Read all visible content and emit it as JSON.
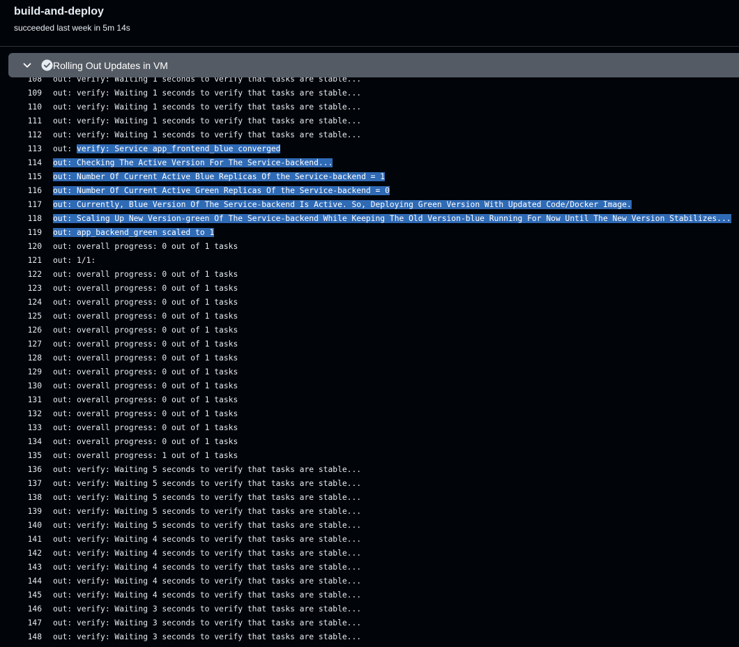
{
  "job": {
    "title": "build-and-deploy",
    "status": "succeeded last week in 5m 14s"
  },
  "step": {
    "title": "Rolling Out Updates in VM",
    "state_icon": "check-circle-icon",
    "expand_icon": "chevron-down-icon"
  },
  "colors": {
    "background": "#010409",
    "step_header": "#545b64",
    "selection": "#2f6ab5"
  },
  "log_lines": [
    {
      "num": "108",
      "text": "out: verify: Waiting 1 seconds to verify that tasks are stable...",
      "sel_start": null
    },
    {
      "num": "109",
      "text": "out: verify: Waiting 1 seconds to verify that tasks are stable...",
      "sel_start": null
    },
    {
      "num": "110",
      "text": "out: verify: Waiting 1 seconds to verify that tasks are stable...",
      "sel_start": null
    },
    {
      "num": "111",
      "text": "out: verify: Waiting 1 seconds to verify that tasks are stable...",
      "sel_start": null
    },
    {
      "num": "112",
      "text": "out: verify: Waiting 1 seconds to verify that tasks are stable...",
      "sel_start": null
    },
    {
      "num": "113",
      "text": "out: verify: Service app_frontend_blue converged",
      "sel_start": 5
    },
    {
      "num": "114",
      "text": "out: Checking The Active Version For The Service-backend...",
      "sel_start": 0
    },
    {
      "num": "115",
      "text": "out: Number Of Current Active Blue Replicas Of the Service-backend = 1",
      "sel_start": 0
    },
    {
      "num": "116",
      "text": "out: Number Of Current Active Green Replicas Of the Service-backend = 0",
      "sel_start": 0
    },
    {
      "num": "117",
      "text": "out: Currently, Blue Version Of The Service-backend Is Active. So, Deploying Green Version With Updated Code/Docker Image.",
      "sel_start": 0
    },
    {
      "num": "118",
      "text": "out: Scaling Up New Version-green Of The Service-backend While Keeping The Old Version-blue Running For Now Until The New Version Stabilizes...",
      "sel_start": 0
    },
    {
      "num": "119",
      "text": "out: app_backend_green scaled to 1",
      "sel_start": 0
    },
    {
      "num": "120",
      "text": "out: overall progress: 0 out of 1 tasks",
      "sel_start": null
    },
    {
      "num": "121",
      "text": "out: 1/1:",
      "sel_start": null
    },
    {
      "num": "122",
      "text": "out: overall progress: 0 out of 1 tasks",
      "sel_start": null
    },
    {
      "num": "123",
      "text": "out: overall progress: 0 out of 1 tasks",
      "sel_start": null
    },
    {
      "num": "124",
      "text": "out: overall progress: 0 out of 1 tasks",
      "sel_start": null
    },
    {
      "num": "125",
      "text": "out: overall progress: 0 out of 1 tasks",
      "sel_start": null
    },
    {
      "num": "126",
      "text": "out: overall progress: 0 out of 1 tasks",
      "sel_start": null
    },
    {
      "num": "127",
      "text": "out: overall progress: 0 out of 1 tasks",
      "sel_start": null
    },
    {
      "num": "128",
      "text": "out: overall progress: 0 out of 1 tasks",
      "sel_start": null
    },
    {
      "num": "129",
      "text": "out: overall progress: 0 out of 1 tasks",
      "sel_start": null
    },
    {
      "num": "130",
      "text": "out: overall progress: 0 out of 1 tasks",
      "sel_start": null
    },
    {
      "num": "131",
      "text": "out: overall progress: 0 out of 1 tasks",
      "sel_start": null
    },
    {
      "num": "132",
      "text": "out: overall progress: 0 out of 1 tasks",
      "sel_start": null
    },
    {
      "num": "133",
      "text": "out: overall progress: 0 out of 1 tasks",
      "sel_start": null
    },
    {
      "num": "134",
      "text": "out: overall progress: 0 out of 1 tasks",
      "sel_start": null
    },
    {
      "num": "135",
      "text": "out: overall progress: 1 out of 1 tasks",
      "sel_start": null
    },
    {
      "num": "136",
      "text": "out: verify: Waiting 5 seconds to verify that tasks are stable...",
      "sel_start": null
    },
    {
      "num": "137",
      "text": "out: verify: Waiting 5 seconds to verify that tasks are stable...",
      "sel_start": null
    },
    {
      "num": "138",
      "text": "out: verify: Waiting 5 seconds to verify that tasks are stable...",
      "sel_start": null
    },
    {
      "num": "139",
      "text": "out: verify: Waiting 5 seconds to verify that tasks are stable...",
      "sel_start": null
    },
    {
      "num": "140",
      "text": "out: verify: Waiting 5 seconds to verify that tasks are stable...",
      "sel_start": null
    },
    {
      "num": "141",
      "text": "out: verify: Waiting 4 seconds to verify that tasks are stable...",
      "sel_start": null
    },
    {
      "num": "142",
      "text": "out: verify: Waiting 4 seconds to verify that tasks are stable...",
      "sel_start": null
    },
    {
      "num": "143",
      "text": "out: verify: Waiting 4 seconds to verify that tasks are stable...",
      "sel_start": null
    },
    {
      "num": "144",
      "text": "out: verify: Waiting 4 seconds to verify that tasks are stable...",
      "sel_start": null
    },
    {
      "num": "145",
      "text": "out: verify: Waiting 4 seconds to verify that tasks are stable...",
      "sel_start": null
    },
    {
      "num": "146",
      "text": "out: verify: Waiting 3 seconds to verify that tasks are stable...",
      "sel_start": null
    },
    {
      "num": "147",
      "text": "out: verify: Waiting 3 seconds to verify that tasks are stable...",
      "sel_start": null
    },
    {
      "num": "148",
      "text": "out: verify: Waiting 3 seconds to verify that tasks are stable...",
      "sel_start": null
    }
  ]
}
